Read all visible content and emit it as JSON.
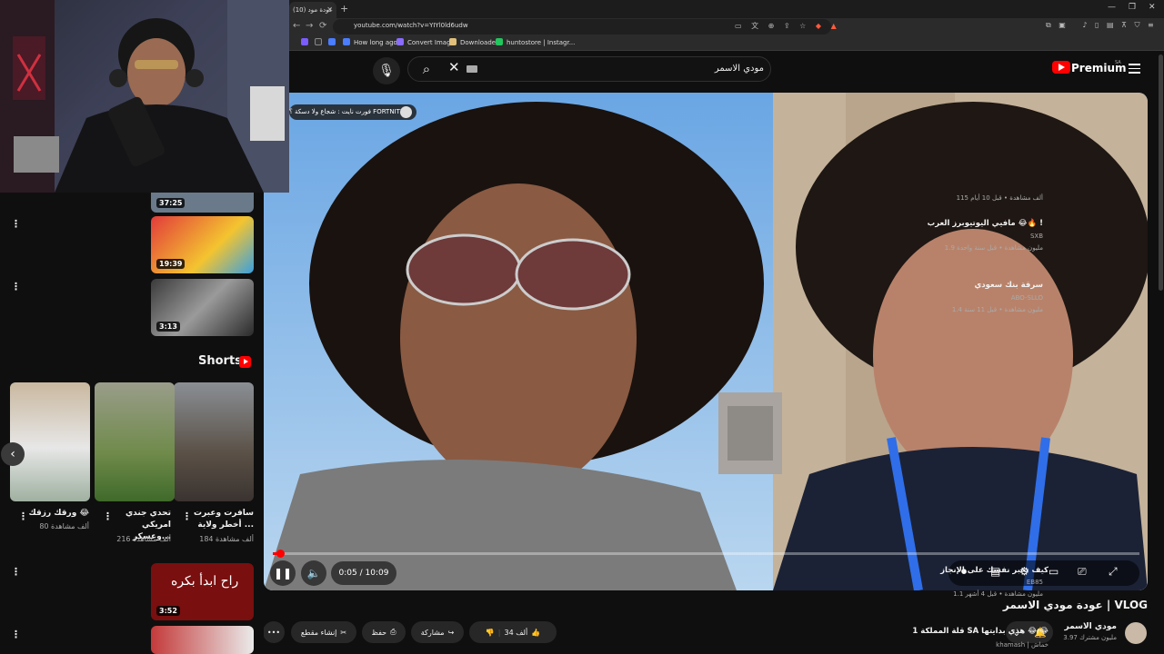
{
  "browser": {
    "tab_title": "(10) عودة مود",
    "url": "youtube.com/watch?v=YIYl0ld6udw",
    "bookmarks": [
      "How long ago",
      "Convert Image",
      "Downloader",
      "huntostore | Instagr..."
    ]
  },
  "header": {
    "search_query": "مودي الاسمر",
    "logo_text": "Premium",
    "region": "SA"
  },
  "player": {
    "chip_text": "فورت نايت : شجاع ولا دسكة ؟ FORTNITE",
    "time": "0:05 / 10:09",
    "progress_fraction": 0.008
  },
  "video": {
    "title": "عودة مودي الاسمر | VLOG",
    "channel": "مودي الاسمر",
    "subscribers": "3.97 مليون مشترك",
    "like_count": "34 ألف",
    "share_label": "مشاركة",
    "save_label": "حفظ",
    "clip_label": "إنشاء مقطع"
  },
  "sidebar": {
    "partial_item": {
      "meta": "115 ألف مشاهدة • قبل 10 أيام",
      "duration": "37:25"
    },
    "items": [
      {
        "title": "مافيي اليوتيوبرز العرب 😂🔥 !",
        "channel": "SXB",
        "meta": "1.9 مليون مشاهدة • قبل سنة واحدة",
        "duration": "19:39"
      },
      {
        "title": "سرقة بنك سعودي",
        "channel": "ABO-SLLO",
        "meta": "1.4 مليون مشاهدة • قبل 11 سنة",
        "duration": "3:13"
      }
    ],
    "shorts_label": "Shorts",
    "shorts": [
      {
        "title": "سافرت وعبرت أخطر ولاية ...",
        "views": "184 ألف مشاهدة"
      },
      {
        "title": "تحدي جندي امريكي وعسكر...",
        "views": "216 ألف مشاهدة"
      },
      {
        "title": "ورقك رزقك 😂",
        "views": "80 ألف مشاهدة"
      }
    ],
    "items2": [
      {
        "title": "كيف تجبر نفسك على الإنجاز",
        "channel": "EB85",
        "meta": "1.1 مليون مشاهدة • قبل 4 أشهر",
        "duration": "3:52",
        "thumb_text": "راح ابدأ بكره"
      },
      {
        "title": "قلة المملكة 1 SA هذي بدايتها 😂 😂",
        "channel": "khamash | خماش",
        "meta": "",
        "duration": ""
      }
    ]
  },
  "colors": {
    "accent": "#ff0000",
    "bg": "#0f0f0f",
    "chip": "#272727"
  }
}
